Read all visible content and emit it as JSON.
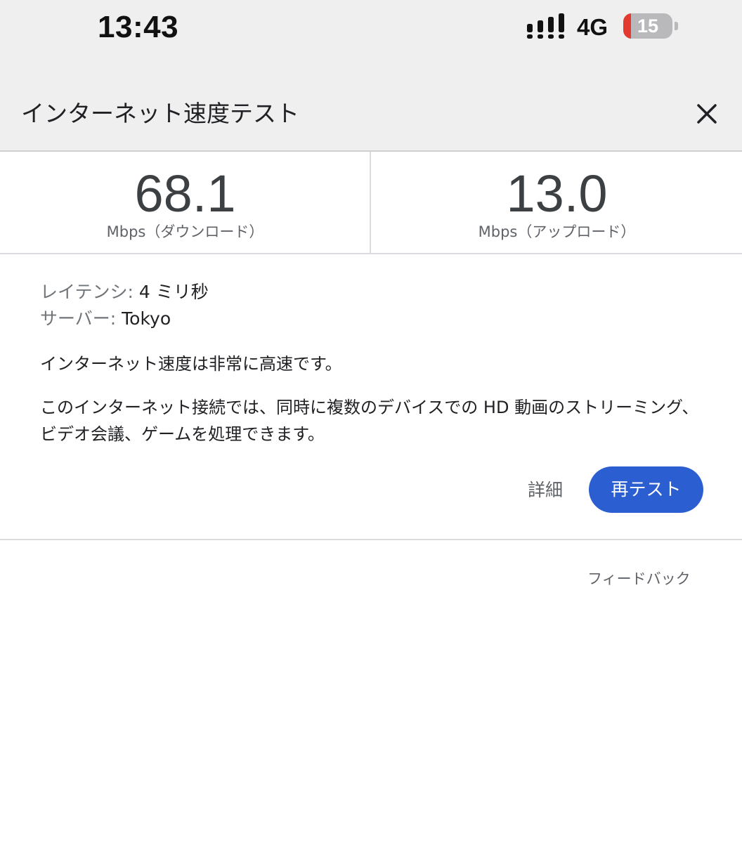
{
  "status_bar": {
    "time": "13:43",
    "network": "4G",
    "battery_level": "15",
    "battery_fill_percent": 15,
    "icons": [
      "signal-icon",
      "battery-icon"
    ]
  },
  "header": {
    "title": "インターネット速度テスト",
    "close_icon": "close-icon"
  },
  "results": {
    "download": {
      "value": "68.1",
      "unit": "Mbps（ダウンロード）"
    },
    "upload": {
      "value": "13.0",
      "unit": "Mbps（アップロード）"
    }
  },
  "details": {
    "latency_label": "レイテンシ: ",
    "latency_value": "4 ミリ秒",
    "server_label": "サーバー: ",
    "server_value": "Tokyo",
    "summary": "インターネット速度は非常に高速です。",
    "description": "このインターネット接続では、同時に複数のデバイスでの HD 動画のストリーミング、ビデオ会議、ゲームを処理できます。"
  },
  "actions": {
    "details_label": "詳細",
    "retest_label": "再テスト"
  },
  "footer": {
    "feedback_label": "フィードバック"
  },
  "colors": {
    "accent": "#2b5fd1",
    "battery_low": "#e33a30",
    "header_bg": "#efeff0"
  }
}
